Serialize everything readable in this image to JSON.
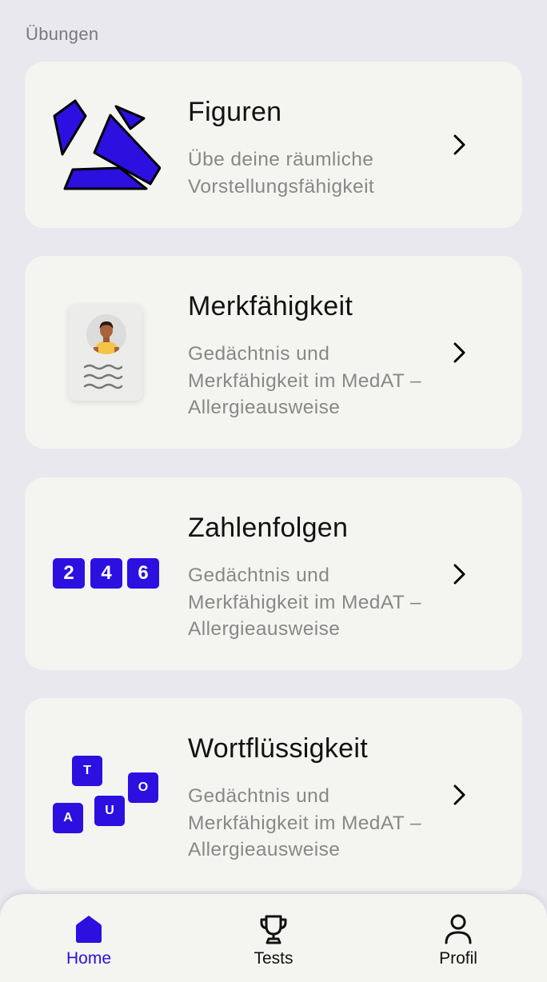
{
  "section": {
    "title": "Übungen"
  },
  "cards": [
    {
      "title": "Figuren",
      "description": "Übe deine räumliche Vorstellungsfähigkeit"
    },
    {
      "title": "Merkfähigkeit",
      "description": "Gedächtnis und Merkfähigkeit im MedAT – Allergieausweise"
    },
    {
      "title": "Zahlenfolgen",
      "description": "Gedächtnis und Merkfähigkeit im MedAT – Allergieausweise",
      "numbers": [
        "2",
        "4",
        "6"
      ]
    },
    {
      "title": "Wortflüssigkeit",
      "description": "Gedächtnis und Merkfähigkeit im MedAT – Allergieausweise",
      "letters": [
        "T",
        "O",
        "A",
        "U"
      ]
    }
  ],
  "nav": {
    "items": [
      {
        "label": "Home",
        "icon": "home-icon",
        "active": true
      },
      {
        "label": "Tests",
        "icon": "trophy-icon",
        "active": false
      },
      {
        "label": "Profil",
        "icon": "profile-icon",
        "active": false
      }
    ]
  },
  "colors": {
    "accent": "#2b10e0",
    "card": "#f4f4f1",
    "background": "#e8e8ee"
  }
}
